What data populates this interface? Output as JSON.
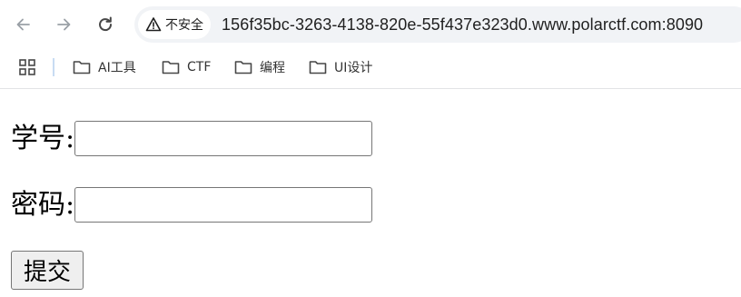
{
  "browser": {
    "nav": {
      "back_icon": "arrow-left-icon",
      "forward_icon": "arrow-right-icon",
      "reload_icon": "reload-icon"
    },
    "security_label": "不安全",
    "url": "156f35bc-3263-4138-820e-55f437e323d0.www.polarctf.com:8090",
    "bookmarks": [
      {
        "label": "AI工具"
      },
      {
        "label": "CTF"
      },
      {
        "label": "编程"
      },
      {
        "label": "UI设计"
      }
    ]
  },
  "form": {
    "student_id_label": "学号:",
    "student_id_value": "",
    "password_label": "密码:",
    "password_value": "",
    "submit_label": "提交"
  },
  "colors": {
    "omnibox_bg": "#f1f3f6",
    "divider": "#c8dcf3",
    "button_bg": "#efefef",
    "input_border": "#767676"
  }
}
